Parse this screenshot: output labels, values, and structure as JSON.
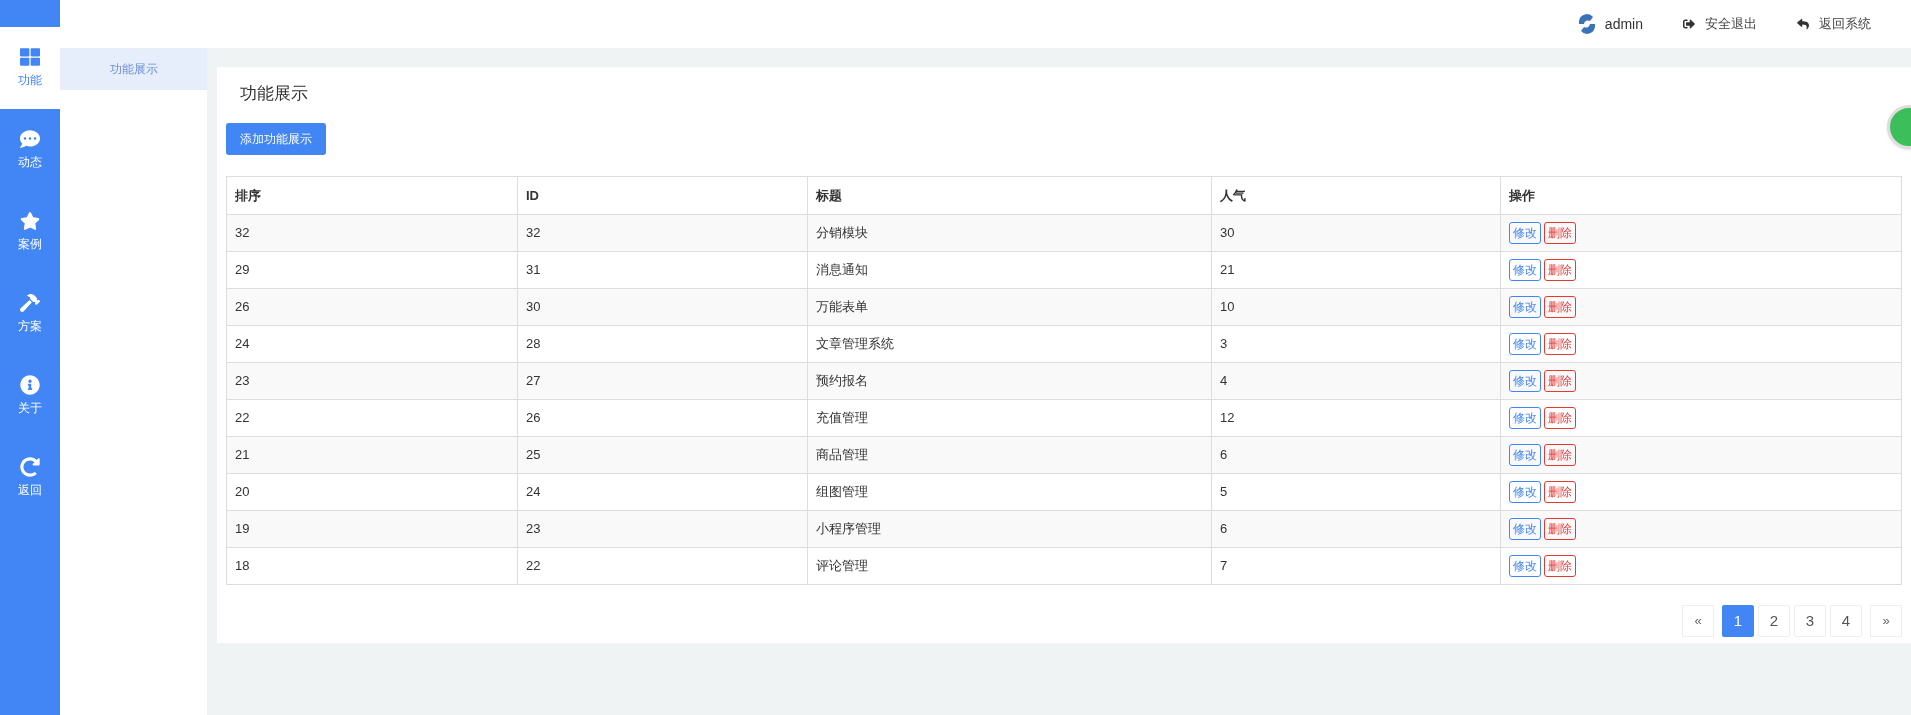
{
  "rail": {
    "items": [
      {
        "label": "功能",
        "kind": "grid",
        "selected": true
      },
      {
        "label": "动态",
        "kind": "chat",
        "selected": false
      },
      {
        "label": "案例",
        "kind": "star",
        "selected": false
      },
      {
        "label": "方案",
        "kind": "hammer",
        "selected": false
      },
      {
        "label": "关于",
        "kind": "info",
        "selected": false
      },
      {
        "label": "返回",
        "kind": "redo",
        "selected": false
      }
    ]
  },
  "subnav": {
    "items": [
      {
        "label": "功能展示",
        "selected": true
      }
    ]
  },
  "header": {
    "user": "admin",
    "links": [
      {
        "label": "安全退出",
        "kind": "logout"
      },
      {
        "label": "返回系统",
        "kind": "back"
      }
    ]
  },
  "page": {
    "title": "功能展示",
    "add_button": "添加功能展示"
  },
  "table": {
    "columns": [
      "排序",
      "ID",
      "标题",
      "人气",
      "操作"
    ],
    "rows": [
      {
        "cells": [
          "32",
          "32",
          "分销模块",
          "30"
        ],
        "actions": [
          "修改",
          "删除"
        ]
      },
      {
        "cells": [
          "29",
          "31",
          "消息通知",
          "21"
        ],
        "actions": [
          "修改",
          "删除"
        ]
      },
      {
        "cells": [
          "26",
          "30",
          "万能表单",
          "10"
        ],
        "actions": [
          "修改",
          "删除"
        ]
      },
      {
        "cells": [
          "24",
          "28",
          "文章管理系统",
          "3"
        ],
        "actions": [
          "修改",
          "删除"
        ]
      },
      {
        "cells": [
          "23",
          "27",
          "预约报名",
          "4"
        ],
        "actions": [
          "修改",
          "删除"
        ]
      },
      {
        "cells": [
          "22",
          "26",
          "充值管理",
          "12"
        ],
        "actions": [
          "修改",
          "删除"
        ]
      },
      {
        "cells": [
          "21",
          "25",
          "商品管理",
          "6"
        ],
        "actions": [
          "修改",
          "删除"
        ]
      },
      {
        "cells": [
          "20",
          "24",
          "组图管理",
          "5"
        ],
        "actions": [
          "修改",
          "删除"
        ]
      },
      {
        "cells": [
          "19",
          "23",
          "小程序管理",
          "6"
        ],
        "actions": [
          "修改",
          "删除"
        ]
      },
      {
        "cells": [
          "18",
          "22",
          "评论管理",
          "7"
        ],
        "actions": [
          "修改",
          "删除"
        ]
      }
    ]
  },
  "pagination": {
    "prev": "«",
    "pages": [
      {
        "label": "1",
        "selected": true
      },
      {
        "label": "2",
        "selected": false
      },
      {
        "label": "3",
        "selected": false
      },
      {
        "label": "4",
        "selected": false
      }
    ],
    "next": "»"
  }
}
